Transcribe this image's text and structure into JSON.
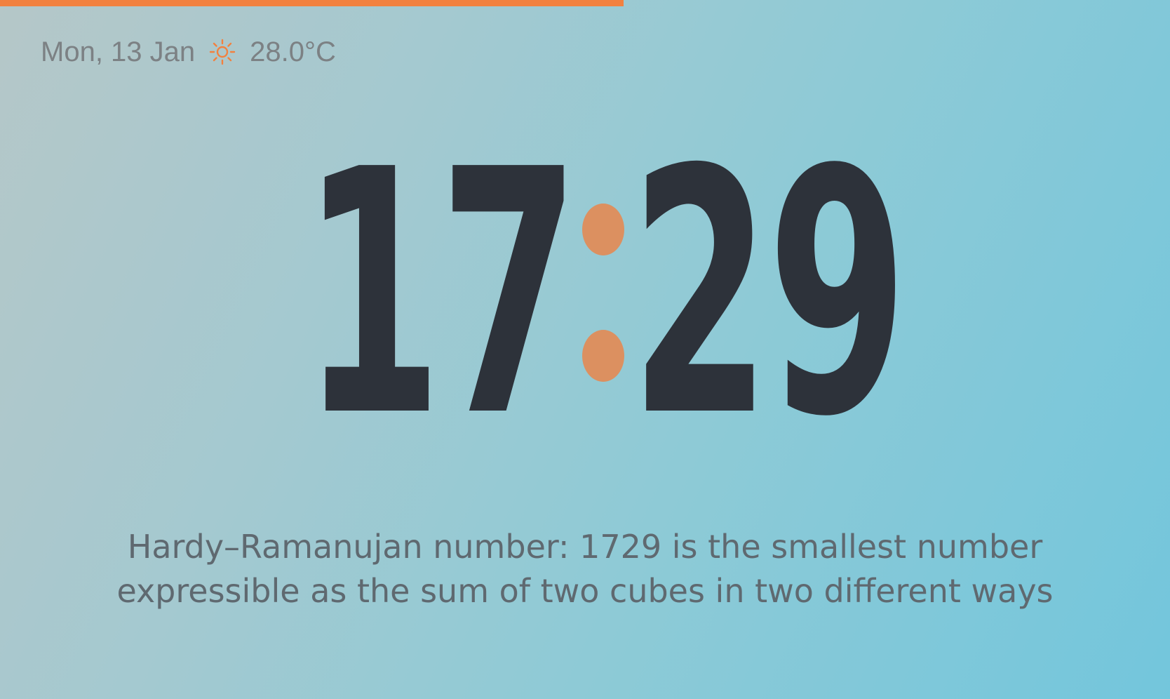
{
  "progress": {
    "fraction": 0.533,
    "color": "#f2813f"
  },
  "status": {
    "date": "Mon, 13 Jan",
    "weather_icon": "sun-icon",
    "temperature": "28.0°C"
  },
  "clock": {
    "hours": "17",
    "minutes": "29",
    "colon_color": "#dc9060"
  },
  "fact": {
    "line1": "Hardy–Ramanujan number: 1729 is the smallest number",
    "line2": "expressible as the sum of two cubes in two different ways"
  }
}
